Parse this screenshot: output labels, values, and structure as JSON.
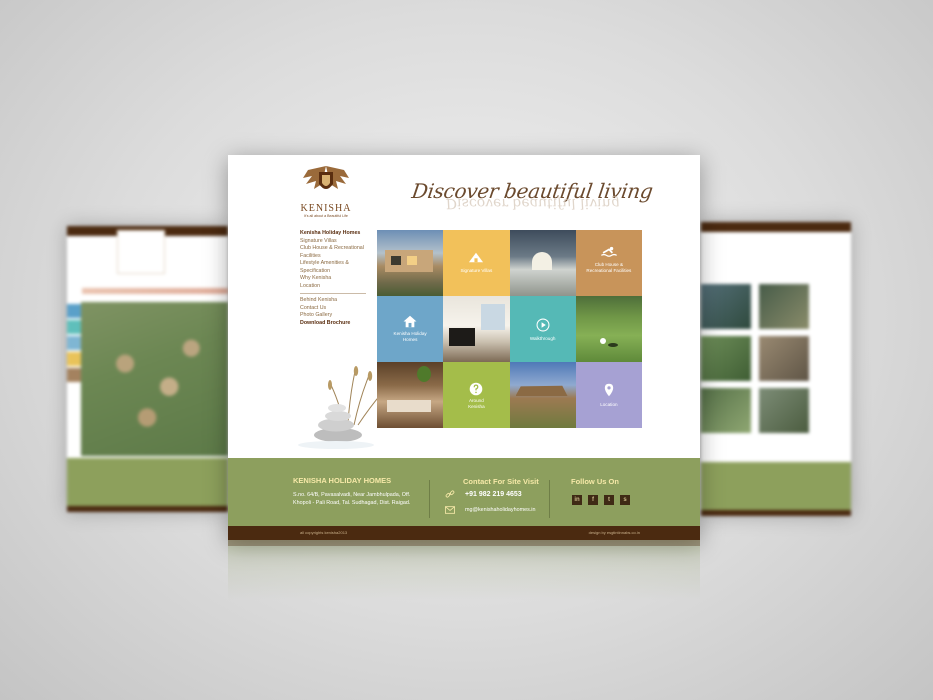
{
  "brand": {
    "name": "KENISHA",
    "tagline": "It's all about a Beautiful Life",
    "hero_text": "Discover beautiful living",
    "colors": {
      "brown": "#4b2a10",
      "green": "#8d9f5e",
      "gold": "#f6e9a8"
    }
  },
  "nav": {
    "primary": [
      "Kenisha Holiday Homes",
      "Signature Villas",
      "Club House & Recreational Facilities",
      "Lifestyle Amenities & Specification",
      "Why Kenisha",
      "Location"
    ],
    "secondary": [
      "Behind Kenisha",
      "Contact Us",
      "Photo Gallery",
      "Download Brochure"
    ]
  },
  "tiles": {
    "signature_villas": "Signature Villas",
    "club_house": "Club House & Recreational Facilities",
    "holiday_homes": "Kenisha Holiday Homes",
    "walkthrough": "Walkthrough",
    "around": "Around Kenisha",
    "location": "Location"
  },
  "footer": {
    "company_title": "KENISHA HOLIDAY HOMES",
    "address": "S.no. 64/B, Pavasalvadi, Near Jambhulpada, Off. Khopoli - Pali Road, Tal. Sudhagad, Dist. Raigad.",
    "contact_title": "Contact For Site Visit",
    "phone": "+91 982 219 4653",
    "email": "mg@kenishaholidayhomes.in",
    "follow_title": "Follow Us On",
    "social": [
      "linkedin-icon",
      "facebook-icon",
      "twitter-icon",
      "skype-icon"
    ],
    "copyright": "all copyrights kenisha2013",
    "design_credit": "design by esgtintinnabs.co.in"
  }
}
